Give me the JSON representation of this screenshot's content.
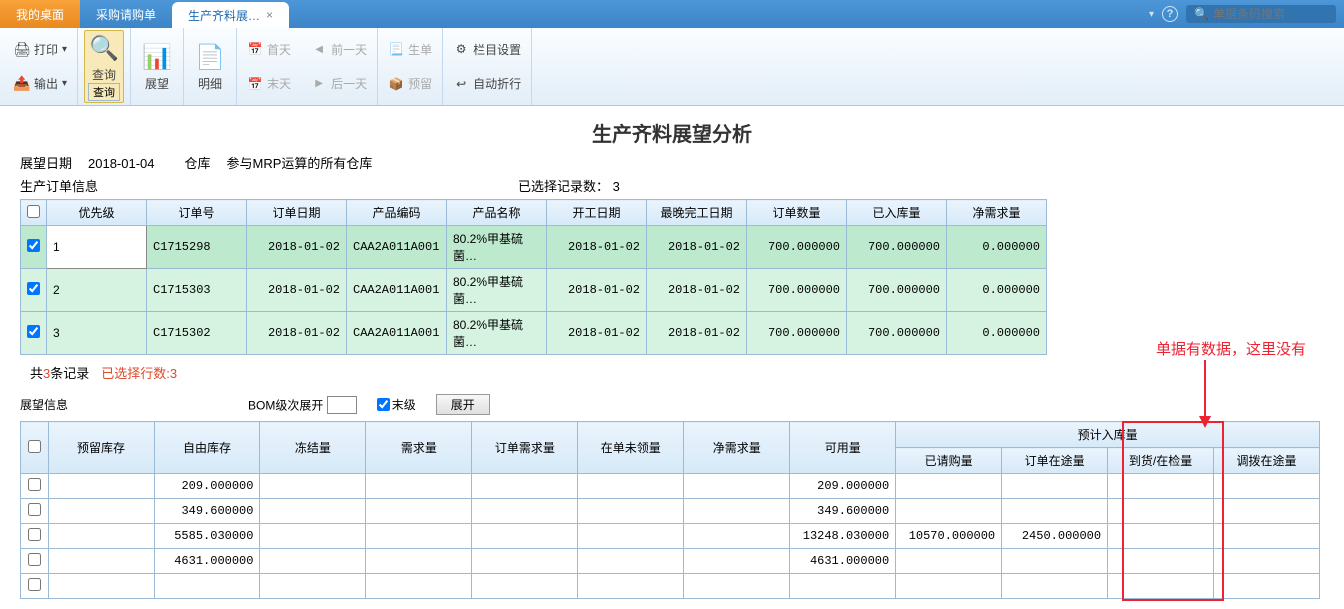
{
  "topbar": {
    "tab_desktop": "我的桌面",
    "tab_purchase": "采购请购单",
    "tab_active": "生产齐料展…",
    "search_placeholder": "单据条码搜索"
  },
  "ribbon": {
    "print": "打印",
    "export": "输出",
    "query": "查询",
    "query_sub": "查询",
    "outlook": "展望",
    "detail": "明细",
    "first_day": "首天",
    "prev_day": "前一天",
    "last_day": "末天",
    "next_day": "后一天",
    "generate": "生单",
    "reserve": "预留",
    "col_set": "栏目设置",
    "auto_wrap": "自动折行"
  },
  "page_title": "生产齐料展望分析",
  "filters": {
    "date_label": "展望日期",
    "date_value": "2018-01-04",
    "whs_label": "仓库",
    "whs_value": "参与MRP运算的所有仓库"
  },
  "section1_title": "生产订单信息",
  "selected_label": "已选择记录数：",
  "selected_count": "3",
  "table1": {
    "headers": [
      "优先级",
      "订单号",
      "订单日期",
      "产品编码",
      "产品名称",
      "开工日期",
      "最晚完工日期",
      "订单数量",
      "已入库量",
      "净需求量"
    ],
    "rows": [
      {
        "chk": true,
        "pri": "1",
        "ord": "C1715298",
        "odate": "2018-01-02",
        "code": "CAA2A011A001",
        "name": "80.2%甲基硫菌…",
        "start": "2018-01-02",
        "end": "2018-01-02",
        "qty": "700.000000",
        "in": "700.000000",
        "net": "0.000000"
      },
      {
        "chk": true,
        "pri": "2",
        "ord": "C1715303",
        "odate": "2018-01-02",
        "code": "CAA2A011A001",
        "name": "80.2%甲基硫菌…",
        "start": "2018-01-02",
        "end": "2018-01-02",
        "qty": "700.000000",
        "in": "700.000000",
        "net": "0.000000"
      },
      {
        "chk": true,
        "pri": "3",
        "ord": "C1715302",
        "odate": "2018-01-02",
        "code": "CAA2A011A001",
        "name": "80.2%甲基硫菌…",
        "start": "2018-01-02",
        "end": "2018-01-02",
        "qty": "700.000000",
        "in": "700.000000",
        "net": "0.000000"
      }
    ]
  },
  "summary": {
    "total_a": "共",
    "total_n": "3",
    "total_b": "条记录",
    "sel": "已选择行数:3"
  },
  "section2": {
    "title": "展望信息",
    "bom_label": "BOM级次展开",
    "leaf_label": "末级",
    "expand": "展开"
  },
  "table2": {
    "top_headers": [
      "预留库存",
      "自由库存",
      "冻结量",
      "需求量",
      "订单需求量",
      "在单未领量",
      "净需求量",
      "可用量"
    ],
    "group_header": "预计入库量",
    "sub_headers": [
      "已请购量",
      "订单在途量",
      "到货/在检量",
      "调拨在途量"
    ],
    "rows": [
      {
        "free": "209.000000",
        "avail": "209.000000"
      },
      {
        "free": "349.600000",
        "avail": "349.600000"
      },
      {
        "free": "5585.030000",
        "avail": "13248.030000",
        "req": "10570.000000",
        "transit": "2450.000000"
      },
      {
        "free": "4631.000000",
        "avail": "4631.000000"
      },
      {}
    ]
  },
  "annotation": "单据有数据，这里没有"
}
